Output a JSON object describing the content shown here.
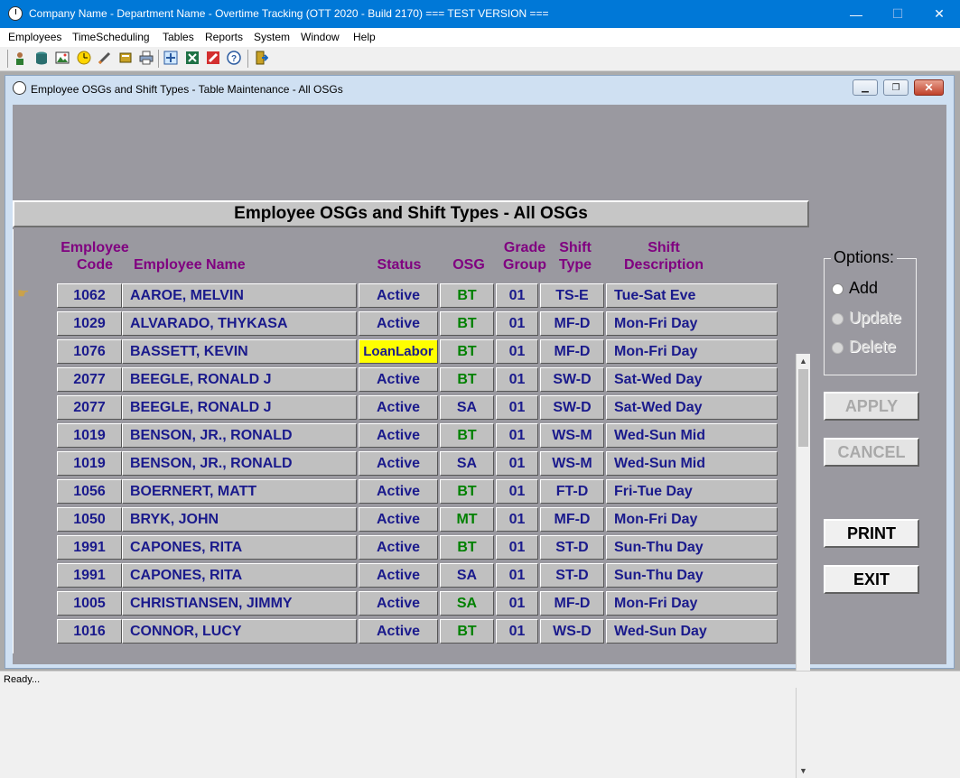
{
  "app": {
    "title": "Company Name - Department Name - Overtime Tracking (OTT 2020 - Build 2170)  === TEST VERSION ===",
    "minimize": "—",
    "maximize": "☐",
    "close": "✕"
  },
  "menu": [
    "Employees",
    "TimeScheduling",
    "Tables",
    "Reports",
    "System",
    "Window",
    "Help"
  ],
  "child_window": {
    "title": "Employee OSGs and Shift Types - Table Maintenance - All OSGs"
  },
  "grid": {
    "heading": "Employee OSGs and Shift Types - All OSGs",
    "columns": {
      "code_1": "Employee",
      "code_2": "Code",
      "name": "Employee Name",
      "status": "Status",
      "osg": "OSG",
      "grade_1": "Grade",
      "grade_2": "Group",
      "type_1": "Shift",
      "type_2": "Type",
      "desc_1": "Shift",
      "desc_2": "Description"
    },
    "rows": [
      {
        "code": "1062",
        "name": "AAROE, MELVIN",
        "status": "Active",
        "osg": "BT",
        "grade": "01",
        "shift_type": "TS-E",
        "shift_desc": "Tue-Sat Eve"
      },
      {
        "code": "1029",
        "name": "ALVARADO, THYKASA",
        "status": "Active",
        "osg": "BT",
        "grade": "01",
        "shift_type": "MF-D",
        "shift_desc": "Mon-Fri Day"
      },
      {
        "code": "1076",
        "name": "BASSETT, KEVIN",
        "status": "LoanLabor",
        "osg": "BT",
        "grade": "01",
        "shift_type": "MF-D",
        "shift_desc": "Mon-Fri Day"
      },
      {
        "code": "2077",
        "name": "BEEGLE, RONALD J",
        "status": "Active",
        "osg": "BT",
        "grade": "01",
        "shift_type": "SW-D",
        "shift_desc": "Sat-Wed Day"
      },
      {
        "code": "2077",
        "name": "BEEGLE, RONALD J",
        "status": "Active",
        "osg": "SA",
        "grade": "01",
        "shift_type": "SW-D",
        "shift_desc": "Sat-Wed Day"
      },
      {
        "code": "1019",
        "name": "BENSON, JR., RONALD",
        "status": "Active",
        "osg": "BT",
        "grade": "01",
        "shift_type": "WS-M",
        "shift_desc": "Wed-Sun Mid"
      },
      {
        "code": "1019",
        "name": "BENSON, JR., RONALD",
        "status": "Active",
        "osg": "SA",
        "grade": "01",
        "shift_type": "WS-M",
        "shift_desc": "Wed-Sun Mid"
      },
      {
        "code": "1056",
        "name": "BOERNERT, MATT",
        "status": "Active",
        "osg": "BT",
        "grade": "01",
        "shift_type": "FT-D",
        "shift_desc": "Fri-Tue Day"
      },
      {
        "code": "1050",
        "name": "BRYK, JOHN",
        "status": "Active",
        "osg": "MT",
        "grade": "01",
        "shift_type": "MF-D",
        "shift_desc": "Mon-Fri Day"
      },
      {
        "code": "1991",
        "name": "CAPONES, RITA",
        "status": "Active",
        "osg": "BT",
        "grade": "01",
        "shift_type": "ST-D",
        "shift_desc": "Sun-Thu Day"
      },
      {
        "code": "1991",
        "name": "CAPONES, RITA",
        "status": "Active",
        "osg": "SA",
        "grade": "01",
        "shift_type": "ST-D",
        "shift_desc": "Sun-Thu Day"
      },
      {
        "code": "1005",
        "name": "CHRISTIANSEN, JIMMY",
        "status": "Active",
        "osg": "SA",
        "grade": "01",
        "shift_type": "MF-D",
        "shift_desc": "Mon-Fri Day"
      },
      {
        "code": "1016",
        "name": "CONNOR, LUCY",
        "status": "Active",
        "osg": "BT",
        "grade": "01",
        "shift_type": "WS-D",
        "shift_desc": "Wed-Sun Day"
      }
    ]
  },
  "options": {
    "label": "Options:",
    "add": "Add",
    "update": "Update",
    "delete": "Delete"
  },
  "buttons": {
    "apply": "APPLY",
    "cancel": "CANCEL",
    "print": "PRINT",
    "exit": "EXIT"
  },
  "status": "Ready...",
  "colors": {
    "title_bar": "#0078d7",
    "column_header": "#800080",
    "cell_text": "#1a1a8c",
    "osg_green": "#008000",
    "loan_highlight": "#ffff00"
  }
}
